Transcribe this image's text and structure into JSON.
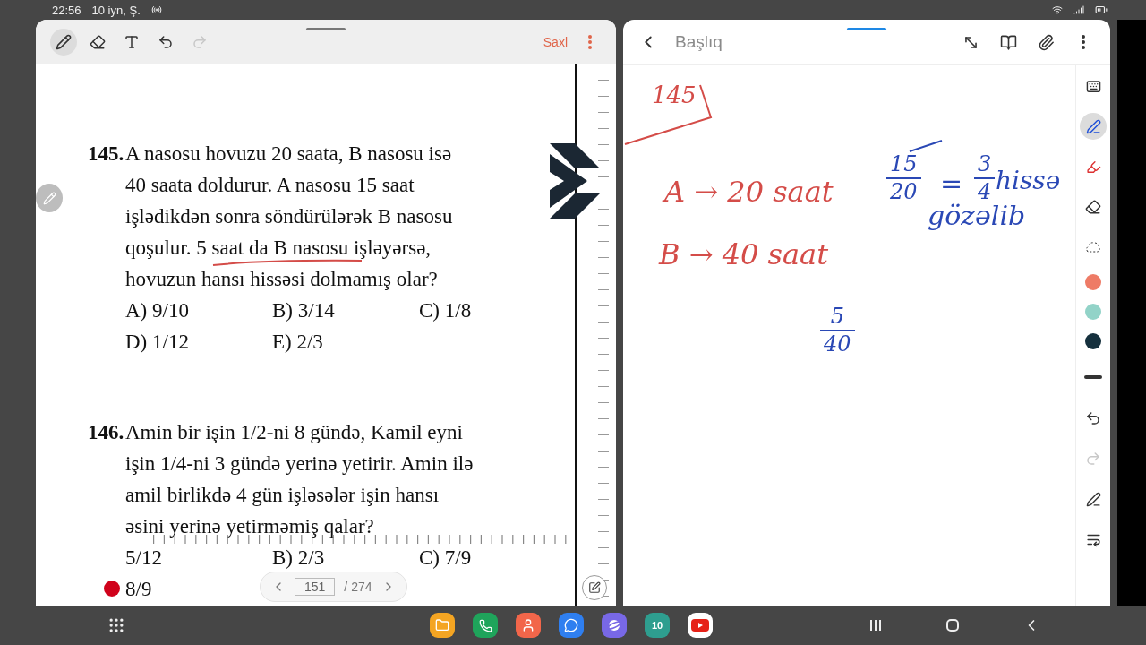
{
  "status_bar": {
    "time": "22:56",
    "date": "10 iyn, Ş."
  },
  "pdf_viewer": {
    "tools": [
      {
        "kind": "pen",
        "selected": true
      },
      {
        "kind": "eraser",
        "selected": false
      },
      {
        "kind": "text",
        "selected": false
      }
    ],
    "history": [
      {
        "kind": "undo",
        "disabled": false
      },
      {
        "kind": "redo",
        "disabled": true
      }
    ],
    "save_label": "Saxl",
    "questions": [
      {
        "number": "145.",
        "lines": [
          "A nasosu hovuzu 20 saata, B nasosu isə",
          "40 saata doldurur. A nasosu 15 saat",
          "işlədikdən sonra söndürülərək B nasosu",
          "qoşulur. 5 saat da B nasosu işləyərsə,",
          "hovuzun hansı hissəsi dolmamış olar?"
        ],
        "options": [
          [
            "A) 9/10",
            "B) 3/14",
            "C) 1/8"
          ],
          [
            "D) 1/12",
            "E) 2/3"
          ]
        ]
      },
      {
        "number": "146.",
        "lines": [
          "Amin bir işin 1/2-ni 8 gündə, Kamil eyni",
          "işin 1/4-ni 3 gündə yerinə yetirir. Amin ilə",
          "amil birlikdə 4 gün işləsələr işin hansı",
          "əsini yerinə yetirməmiş qalar?"
        ],
        "options": [
          [
            "5/12",
            "B) 2/3",
            "C) 7/9"
          ],
          [
            "8/9"
          ]
        ]
      }
    ],
    "page_nav": {
      "current": "151",
      "total": "/ 274"
    }
  },
  "notes_app": {
    "title_placeholder": "Başlıq",
    "notes": [
      {
        "kind": "boxed",
        "text": "145",
        "color": "#d44c48"
      },
      {
        "kind": "text",
        "text": "A → 20 saat",
        "color": "#d44c48"
      },
      {
        "kind": "text",
        "text": "B → 40 saat",
        "color": "#d44c48"
      },
      {
        "kind": "fraction",
        "numerator": "15",
        "denominator": "20",
        "struck": true,
        "color": "#2a48b5"
      },
      {
        "kind": "text",
        "text": "=",
        "color": "#2a48b5"
      },
      {
        "kind": "fraction",
        "numerator": "3",
        "denominator": "4",
        "struck": false,
        "color": "#2a48b5"
      },
      {
        "kind": "text",
        "text": "hissə",
        "color": "#2a48b5"
      },
      {
        "kind": "text",
        "text": "gözəlib",
        "color": "#2a48b5"
      },
      {
        "kind": "fraction",
        "numerator": "5",
        "denominator": "40",
        "struck": false,
        "color": "#2a48b5"
      }
    ],
    "tools": [
      {
        "kind": "keyboard",
        "selected": false
      },
      {
        "kind": "pen",
        "selected": true
      },
      {
        "kind": "highlighter",
        "selected": false
      },
      {
        "kind": "eraser",
        "selected": false
      },
      {
        "kind": "lasso",
        "selected": false
      }
    ],
    "palette": [
      {
        "color": "#ee7b66"
      },
      {
        "color": "#92d3c8"
      },
      {
        "color": "#15303d"
      }
    ],
    "history": [
      {
        "kind": "undo",
        "disabled": false
      },
      {
        "kind": "redo",
        "disabled": true
      }
    ]
  },
  "dock": {
    "calendar_day": "10"
  }
}
